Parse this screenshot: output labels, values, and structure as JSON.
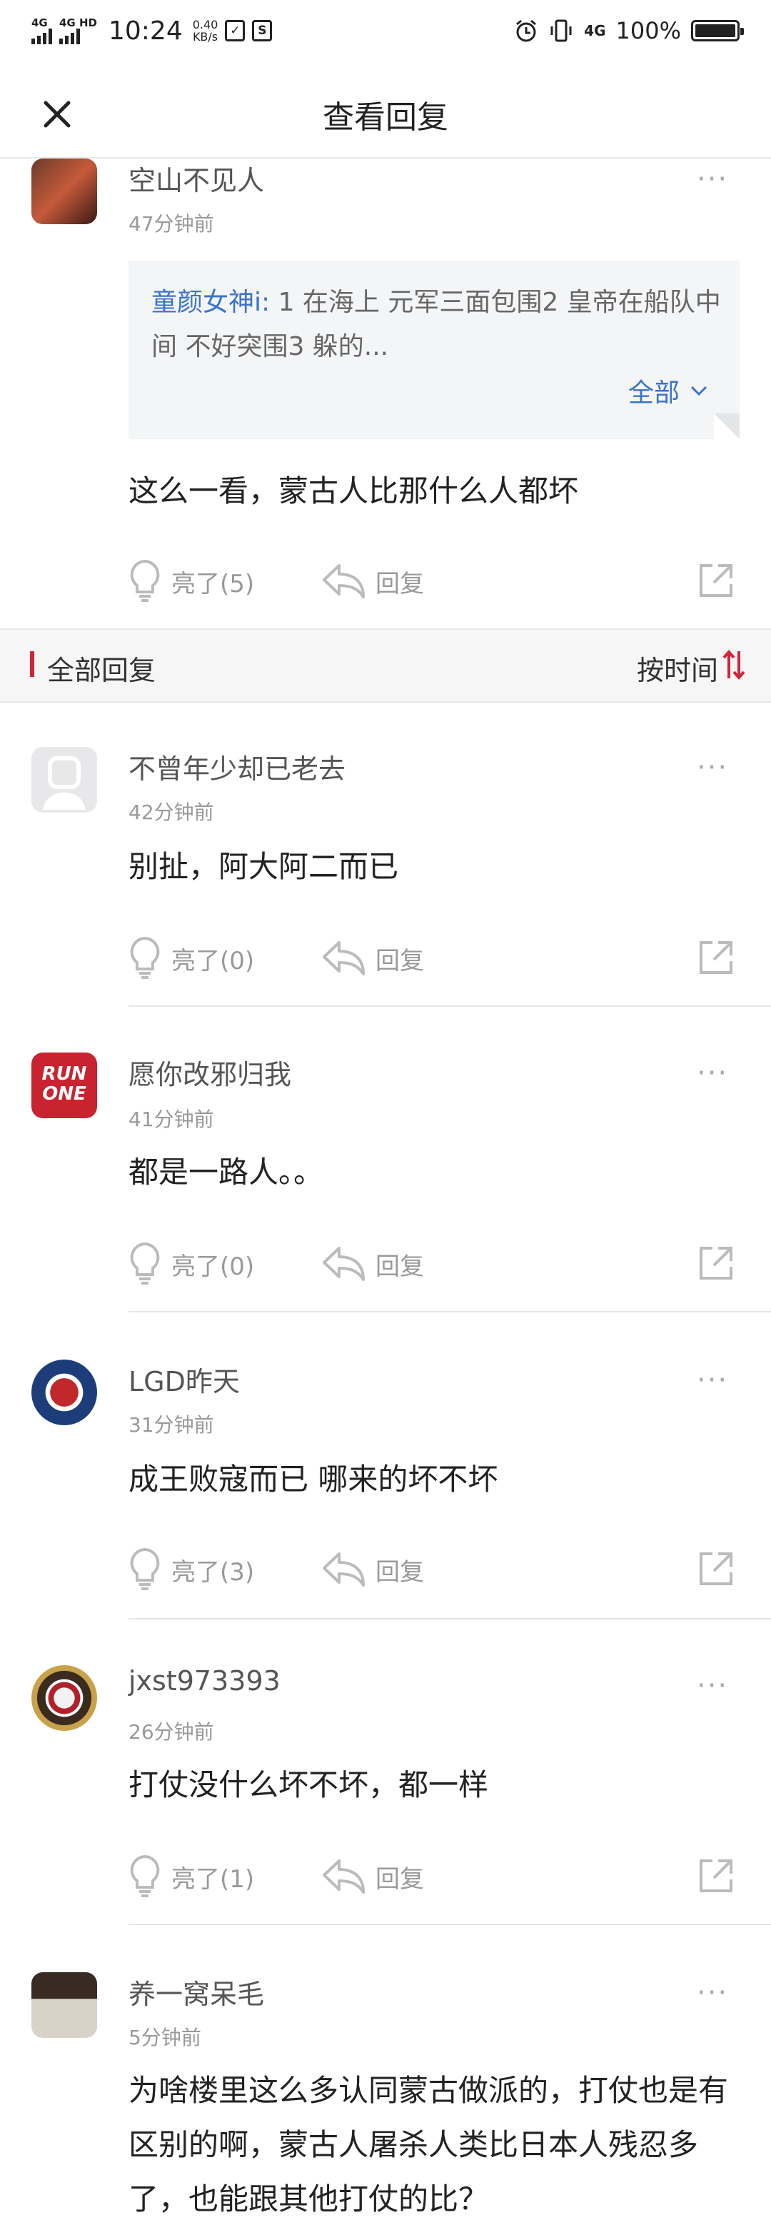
{
  "status_bar": {
    "signal1": "4G",
    "signal2": "4G HD",
    "time": "10:24",
    "speed_value": "0.40",
    "speed_unit": "KB/s",
    "icon_check": "✓",
    "icon_s": "S",
    "net": "4G",
    "battery": "100%"
  },
  "header": {
    "title": "查看回复"
  },
  "original_comment": {
    "username": "空山不见人",
    "time": "47分钟前",
    "quote": {
      "name": "童颜女神i:",
      "text": " 1 在海上 元军三面包围2 皇帝在船队中间 不好突围3 躲的...",
      "more_label": "全部"
    },
    "content": "这么一看，蒙古人比那什么人都坏",
    "like_label": "亮了(5)",
    "reply_label": "回复"
  },
  "sort_bar": {
    "label": "全部回复",
    "sort_label": "按时间"
  },
  "replies": [
    {
      "username": "不曾年少却已老去",
      "time": "42分钟前",
      "content": "别扯，阿大阿二而已",
      "like_label": "亮了(0)",
      "reply_label": "回复"
    },
    {
      "username": "愿你改邪归我",
      "time": "41分钟前",
      "content": "都是一路人。。",
      "like_label": "亮了(0)",
      "reply_label": "回复",
      "avatar_text1": "RUN",
      "avatar_text2": "ONE"
    },
    {
      "username": "LGD昨天",
      "time": "31分钟前",
      "content": "成王败寇而已 哪来的坏不坏",
      "like_label": "亮了(3)",
      "reply_label": "回复"
    },
    {
      "username": "jxst973393",
      "time": "26分钟前",
      "content": "打仗没什么坏不坏，都一样",
      "like_label": "亮了(1)",
      "reply_label": "回复"
    },
    {
      "username": "养一窝呆毛",
      "time": "5分钟前",
      "content": "为啥楼里这么多认同蒙古做派的，打仗也是有区别的啊，蒙古人屠杀人类比日本人残忍多了，也能跟其他打仗的比？"
    }
  ],
  "colors": {
    "accent": "#d0253a",
    "link": "#3a73c9"
  }
}
